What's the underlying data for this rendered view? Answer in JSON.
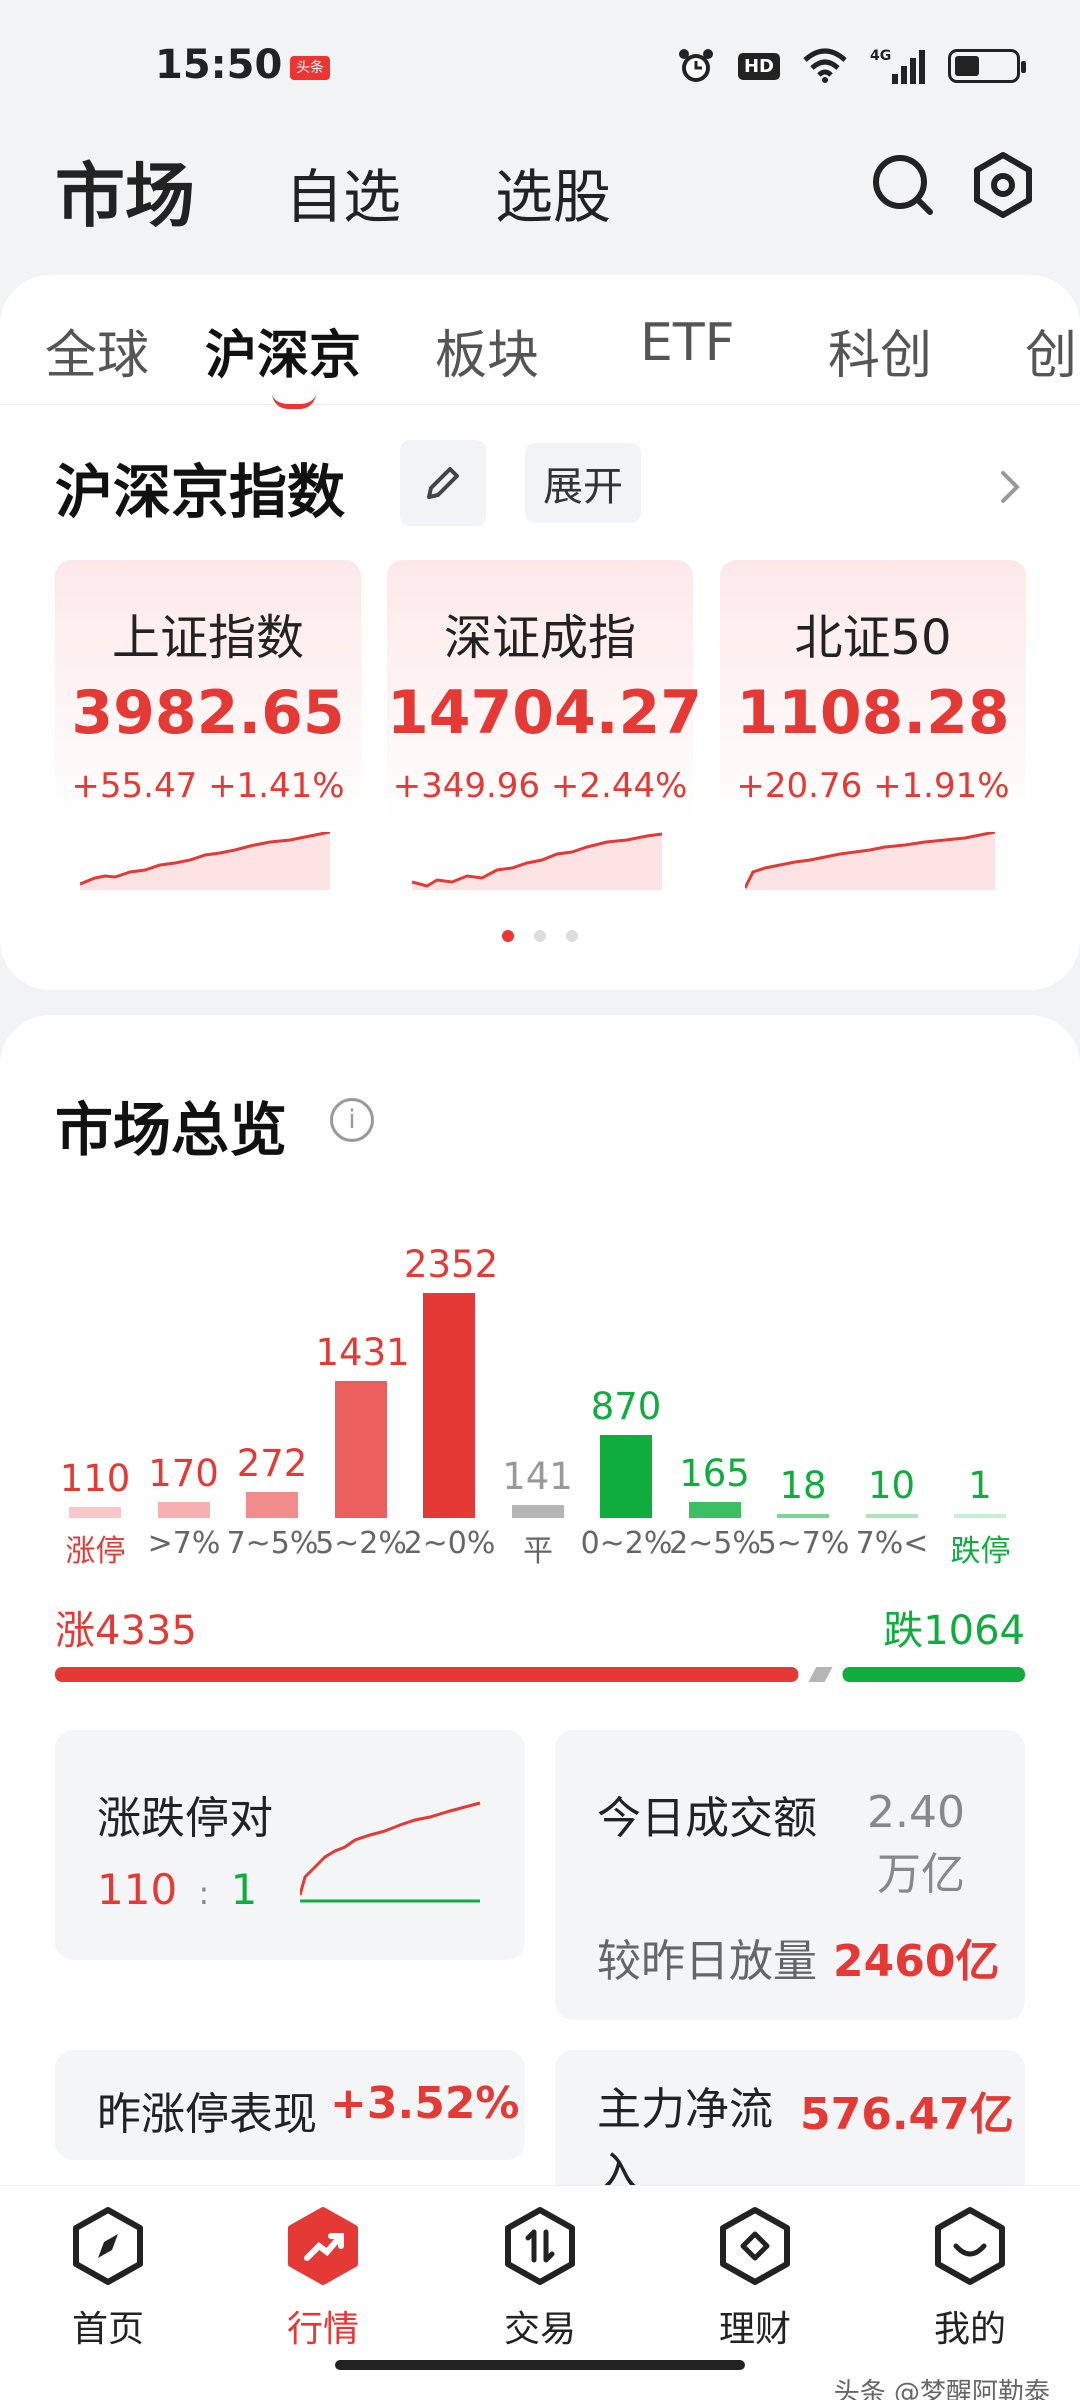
{
  "status_bar": {
    "time": "15:50",
    "app_badge": "头条",
    "hd": "HD",
    "network": "4G"
  },
  "top_nav": {
    "tabs": [
      "市场",
      "自选",
      "选股"
    ]
  },
  "sub_tabs": [
    "全球",
    "沪深京",
    "板块",
    "ETF",
    "科创",
    "创"
  ],
  "indices_section": {
    "title": "沪深京指数",
    "expand_label": "展开",
    "items": [
      {
        "name": "上证指数",
        "value": "3982.65",
        "change": "+55.47",
        "pct": "+1.41%"
      },
      {
        "name": "深证成指",
        "value": "14704.27",
        "change": "+349.96",
        "pct": "+2.44%"
      },
      {
        "name": "北证50",
        "value": "1108.28",
        "change": "+20.76",
        "pct": "+1.91%"
      }
    ]
  },
  "overview": {
    "title": "市场总览",
    "info_icon": "i"
  },
  "chart_data": {
    "type": "bar",
    "categories": [
      "涨停",
      ">7%",
      "7~5%",
      "5~2%",
      "2~0%",
      "平",
      "0~2%",
      "2~5%",
      "5~7%",
      "7%<",
      "跌停"
    ],
    "values": [
      110,
      170,
      272,
      1431,
      2352,
      141,
      870,
      165,
      18,
      10,
      1
    ],
    "colors": [
      "#f9c7c7",
      "#f6b0b0",
      "#f28b8b",
      "#ec5f5f",
      "#e53935",
      "#b5b5b5",
      "#0fad3e",
      "#3cbf62",
      "#7bd596",
      "#aee3bd",
      "#c9ecd2"
    ],
    "label_colors": [
      "#e53935",
      "#e53935",
      "#e53935",
      "#e53935",
      "#e53935",
      "#999999",
      "#0fad3e",
      "#0fad3e",
      "#0fad3e",
      "#0fad3e",
      "#0fad3e"
    ],
    "cat_colors": [
      "#e53935",
      "#666666",
      "#666666",
      "#666666",
      "#666666",
      "#666666",
      "#666666",
      "#666666",
      "#666666",
      "#666666",
      "#0fad3e"
    ]
  },
  "up_down": {
    "up_label": "涨4335",
    "down_label": "跌1064",
    "up_count": 4335,
    "down_count": 1064,
    "flat_count": 141
  },
  "limit_card": {
    "title": "涨跌停对",
    "up": "110",
    "sep": ":",
    "down": "1"
  },
  "turnover_card": {
    "title": "今日成交额",
    "value": "2.40万亿",
    "compare_label": "较昨日放量",
    "compare_value": "2460亿"
  },
  "yesterday_card": {
    "title": "昨涨停表现",
    "value": "+3.52%"
  },
  "mainflow_card": {
    "title": "主力净流入",
    "value": "576.47亿"
  },
  "bottom_nav": {
    "items": [
      {
        "label": "首页",
        "icon": "compass-icon"
      },
      {
        "label": "行情",
        "icon": "trend-icon"
      },
      {
        "label": "交易",
        "icon": "trade-icon"
      },
      {
        "label": "理财",
        "icon": "diamond-icon"
      },
      {
        "label": "我的",
        "icon": "smile-icon"
      }
    ]
  },
  "watermark": "头条 @梦醒阿勒泰",
  "colors": {
    "red": "#e53935",
    "green": "#0fad3e"
  }
}
